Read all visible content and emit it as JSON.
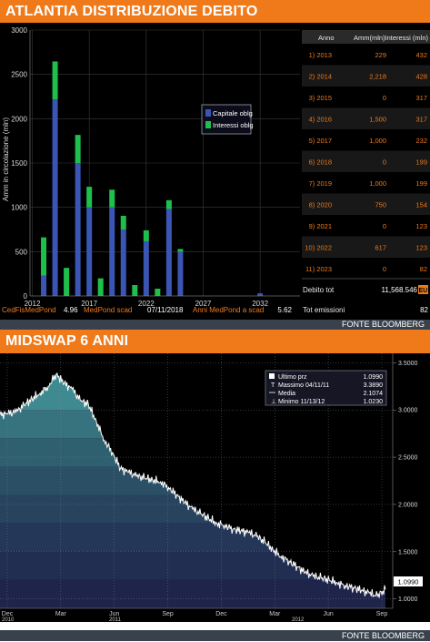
{
  "chart1": {
    "title": "ATLANTIA DISTRIBUZIONE DEBITO",
    "source": "FONTE BLOOMBERG",
    "ylabel": "Amm in circolazione (mln)",
    "legend": [
      "Capitale oblg",
      "Interessi oblg"
    ],
    "table_headers": [
      "Anno",
      "Amm(mln)",
      "Interessi (mln)"
    ],
    "table_rows": [
      [
        "1) 2013",
        "229",
        "432"
      ],
      [
        "2) 2014",
        "2,218",
        "428"
      ],
      [
        "3) 2015",
        "0",
        "317"
      ],
      [
        "4) 2016",
        "1,500",
        "317"
      ],
      [
        "5) 2017",
        "1,000",
        "232"
      ],
      [
        "6) 2018",
        "0",
        "199"
      ],
      [
        "7) 2019",
        "1,000",
        "199"
      ],
      [
        "8) 2020",
        "750",
        "154"
      ],
      [
        "9) 2021",
        "0",
        "123"
      ],
      [
        "10) 2022",
        "617",
        "123"
      ],
      [
        "11) 2023",
        "0",
        "82"
      ]
    ],
    "totals": {
      "debito_label": "Debito tot",
      "debito_value": "11,568.546",
      "debito_unit": "EU",
      "emissioni_label": "Tot emissioni",
      "emissioni_value": "82"
    },
    "footer": {
      "a_label": "CedFisMedPond",
      "a_value": "4.96",
      "b_label": "MedPond scad",
      "b_value": "07/11/2018",
      "c_label": "Anni MedPond a scad",
      "c_value": "5.62"
    },
    "colors": {
      "capitale": "#3a55b4",
      "interessi": "#1fbf4c",
      "label_orange": "#f07a1a"
    }
  },
  "chart2": {
    "title": "MIDSWAP 6 ANNI",
    "source": "FONTE BLOOMBERG",
    "legend": [
      {
        "label": "Ultimo prz",
        "value": "1.0990"
      },
      {
        "label": "Massimo 04/11/11",
        "value": "3.3890"
      },
      {
        "label": "Media",
        "value": "2.1074"
      },
      {
        "label": "Minimo 11/13/12",
        "value": "1.0230"
      }
    ],
    "last_value_label": "1.0990",
    "x_tick_labels": [
      "Dec",
      "Mar",
      "Jun",
      "Sep",
      "Dec",
      "Mar",
      "Jun",
      "Sep"
    ],
    "x_year_labels": [
      "2010",
      "2011",
      "2012"
    ],
    "y_tick_labels": [
      "3.5000",
      "3.0000",
      "2.5000",
      "2.0000",
      "1.5000",
      "1.0000"
    ]
  },
  "chart_data": [
    {
      "type": "bar",
      "title": "ATLANTIA DISTRIBUZIONE DEBITO",
      "ylabel": "Amm in circolazione (mln)",
      "ylim": [
        0,
        3000
      ],
      "y_ticks": [
        0,
        500,
        1000,
        1500,
        2000,
        2500,
        3000
      ],
      "x_ticks": [
        2012,
        2017,
        2022,
        2027,
        2032
      ],
      "xlim": [
        2011.8,
        2035.5
      ],
      "stacked": true,
      "series": [
        {
          "name": "Capitale oblg",
          "x": [
            2013,
            2014,
            2015,
            2016,
            2017,
            2018,
            2019,
            2020,
            2021,
            2022,
            2023,
            2024,
            2025,
            2032
          ],
          "values": [
            229,
            2218,
            0,
            1500,
            1000,
            0,
            1000,
            750,
            0,
            617,
            0,
            980,
            500,
            30
          ]
        },
        {
          "name": "Interessi oblg",
          "x": [
            2013,
            2014,
            2015,
            2016,
            2017,
            2018,
            2019,
            2020,
            2021,
            2022,
            2023,
            2024,
            2025,
            2032
          ],
          "values": [
            432,
            428,
            317,
            317,
            232,
            199,
            199,
            154,
            123,
            123,
            82,
            100,
            30,
            0
          ]
        }
      ]
    },
    {
      "type": "area",
      "title": "MIDSWAP 6 ANNI",
      "ylim": [
        0.9,
        3.6
      ],
      "y_ticks": [
        1.0,
        1.5,
        2.0,
        2.5,
        3.0,
        3.5
      ],
      "x_tick_labels": [
        "Dec",
        "Mar",
        "Jun",
        "Sep",
        "Dec",
        "Mar",
        "Jun",
        "Sep"
      ],
      "series": [
        {
          "name": "Midswap 6 anni",
          "x": [
            0,
            0.5,
            1,
            1.5,
            2,
            2.5,
            3,
            3.5,
            4,
            4.5,
            5,
            5.5,
            6,
            6.5,
            7,
            7.5,
            8,
            8.5,
            9,
            9.5,
            10,
            10.5,
            11,
            11.5,
            12,
            12.5,
            13,
            13.5,
            14,
            14.5,
            15,
            15.5,
            16,
            16.5,
            17,
            17.5,
            18,
            18.5,
            19,
            19.5,
            20,
            20.5,
            21,
            21.5,
            22,
            22.5,
            23,
            23.5,
            24
          ],
          "values": [
            2.95,
            2.96,
            2.98,
            3.05,
            3.12,
            3.18,
            3.25,
            3.38,
            3.28,
            3.22,
            3.1,
            3.06,
            2.88,
            2.68,
            2.55,
            2.38,
            2.34,
            2.3,
            2.28,
            2.26,
            2.24,
            2.18,
            2.1,
            2.02,
            1.95,
            1.9,
            1.85,
            1.8,
            1.78,
            1.74,
            1.72,
            1.7,
            1.66,
            1.6,
            1.52,
            1.45,
            1.4,
            1.34,
            1.28,
            1.24,
            1.22,
            1.2,
            1.17,
            1.14,
            1.12,
            1.09,
            1.06,
            1.03,
            1.1
          ]
        }
      ]
    }
  ]
}
